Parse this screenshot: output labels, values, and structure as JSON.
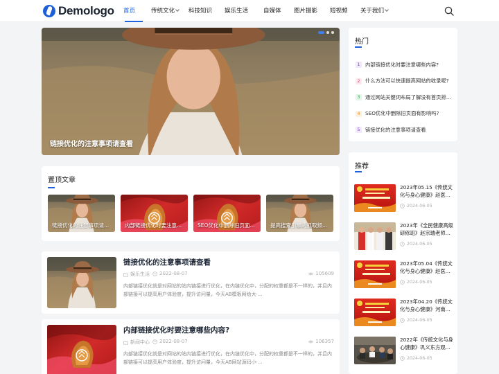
{
  "header": {
    "logo_text": "Demologo",
    "nav": [
      {
        "label": "首页",
        "active": true,
        "dropdown": false
      },
      {
        "label": "传统文化",
        "active": false,
        "dropdown": true
      },
      {
        "label": "科技知识",
        "active": false,
        "dropdown": false
      },
      {
        "label": "娱乐生活",
        "active": false,
        "dropdown": false
      },
      {
        "label": "自媒体",
        "active": false,
        "dropdown": false
      },
      {
        "label": "图片摄影",
        "active": false,
        "dropdown": false
      },
      {
        "label": "短视频",
        "active": false,
        "dropdown": false
      },
      {
        "label": "关于我们",
        "active": false,
        "dropdown": true
      }
    ],
    "search_icon": "search-icon"
  },
  "hero": {
    "title": "链接优化的注意事项请查看",
    "slides": 3,
    "active_slide": 1
  },
  "pinned": {
    "title": "置顶文章",
    "items": [
      {
        "label": "链接优化的注意事项请...",
        "image": "woman"
      },
      {
        "label": "内部链接优化时要注意...",
        "image": "red"
      },
      {
        "label": "SEO优化中删除旧页面...",
        "image": "red"
      },
      {
        "label": "提高搜索引擎的抓取频...",
        "image": "woman"
      }
    ]
  },
  "posts": [
    {
      "title": "链接优化的注意事项请查看",
      "category": "娱乐生活",
      "date": "2022-08-07",
      "views": "105609",
      "excerpt": "内部链接优化就是对网站的站内链接进行优化，在内链优化中，分配的权重都是不一样的，并且内部链接可以提高用户体验度，提升访问量，今天AB模板网给大·...",
      "image": "woman"
    },
    {
      "title": "内部链接优化时要注意哪些内容?",
      "category": "新闻中心",
      "date": "2022-08-07",
      "views": "106357",
      "excerpt": "内部链接优化就是对网站的站内链接进行优化，在内链优化中，分配的权重都是不一样的，并且内部链接可以提高用户体验度，提升访问量，今天AB网站源码小·...",
      "image": "red"
    }
  ],
  "hot": {
    "title": "热门",
    "items": [
      {
        "num": "1",
        "text": "内部链接优化时要注意哪些内容?",
        "color": "#7b3fc4",
        "bg": "#f1e9fb"
      },
      {
        "num": "2",
        "text": "什么方法可以快速提高网站的收录呢?",
        "color": "#e0456b",
        "bg": "#fde8ee"
      },
      {
        "num": "3",
        "text": "通过网站关键词布局了解没有首页排...",
        "color": "#2e9b4e",
        "bg": "#e4f5e9"
      },
      {
        "num": "4",
        "text": "SEO优化中删除旧页面有影响吗?",
        "color": "#e08a1a",
        "bg": "#fdf0de"
      },
      {
        "num": "5",
        "text": "链接优化的注意事项请查看",
        "color": "#7b3fc4",
        "bg": "#f1e9fb"
      }
    ]
  },
  "recommend": {
    "title": "推荐",
    "items": [
      {
        "title": "2023年05.15《传统文化与身心健康》赵医...",
        "date": "2024-06-05",
        "image": "banner"
      },
      {
        "title": "2023年《全民健康高级研修班》赵宗瑞老师...",
        "date": "2024-06-05",
        "image": "people"
      },
      {
        "title": "2023年05.04《传统文化与身心健康》赵医...",
        "date": "2024-06-05",
        "image": "banner"
      },
      {
        "title": "2023年04.20《传统文化与身心健康》河南...",
        "date": "2024-06-05",
        "image": "banner"
      },
      {
        "title": "2022年《传统文化与身心健康》巩义东方观...",
        "date": "2024-06-05",
        "image": "meeting"
      }
    ]
  },
  "colors": {
    "accent": "#1e62e0",
    "background": "#f3f4f6",
    "title": "#1b2433"
  }
}
